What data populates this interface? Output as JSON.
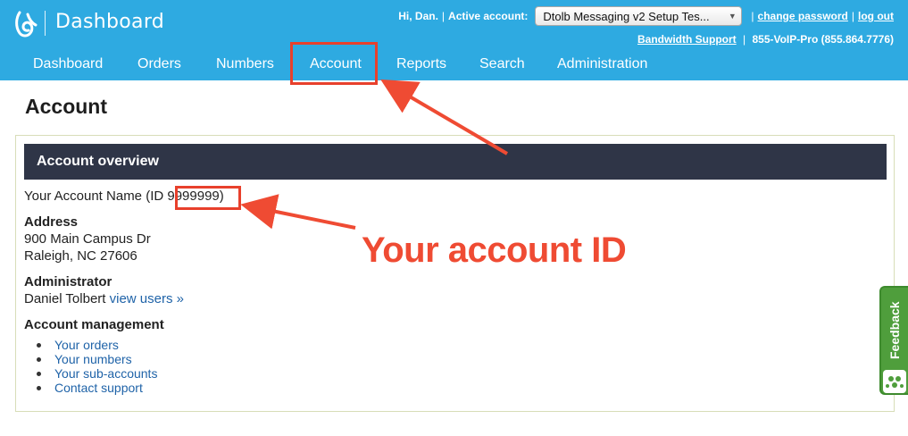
{
  "header": {
    "brand": "Dashboard",
    "greeting": "Hi, Dan.",
    "active_account_label": "Active account:",
    "active_account_value": "Dtolb Messaging v2 Setup Tes...",
    "change_password": "change password",
    "log_out": "log out",
    "bandwidth_support": "Bandwidth Support",
    "support_phone": "855-VoIP-Pro (855.864.7776)",
    "separator": "|"
  },
  "nav": {
    "items": [
      {
        "label": "Dashboard"
      },
      {
        "label": "Orders"
      },
      {
        "label": "Numbers"
      },
      {
        "label": "Account"
      },
      {
        "label": "Reports"
      },
      {
        "label": "Search"
      },
      {
        "label": "Administration"
      }
    ],
    "active_index": 3
  },
  "page": {
    "title": "Account"
  },
  "overview": {
    "header": "Account overview",
    "account_name_prefix": "Your Account Name (ID",
    "account_id": "9999999)",
    "address_heading": "Address",
    "address_line1": "900 Main Campus Dr",
    "address_line2": "Raleigh, NC 27606",
    "admin_heading": "Administrator",
    "admin_name": "Daniel Tolbert",
    "view_users_link": "view users »",
    "management_heading": "Account management",
    "management_links": [
      "Your orders",
      "Your numbers",
      "Your sub-accounts",
      "Contact support"
    ]
  },
  "annotation": {
    "text": "Your account ID",
    "color": "#ef4b33"
  },
  "feedback": {
    "label": "Feedback"
  },
  "colors": {
    "header_bg": "#2eaae1",
    "panel_header_bg": "#2f3547",
    "link": "#1f63a8",
    "feedback_bg": "#4f9e3c"
  }
}
